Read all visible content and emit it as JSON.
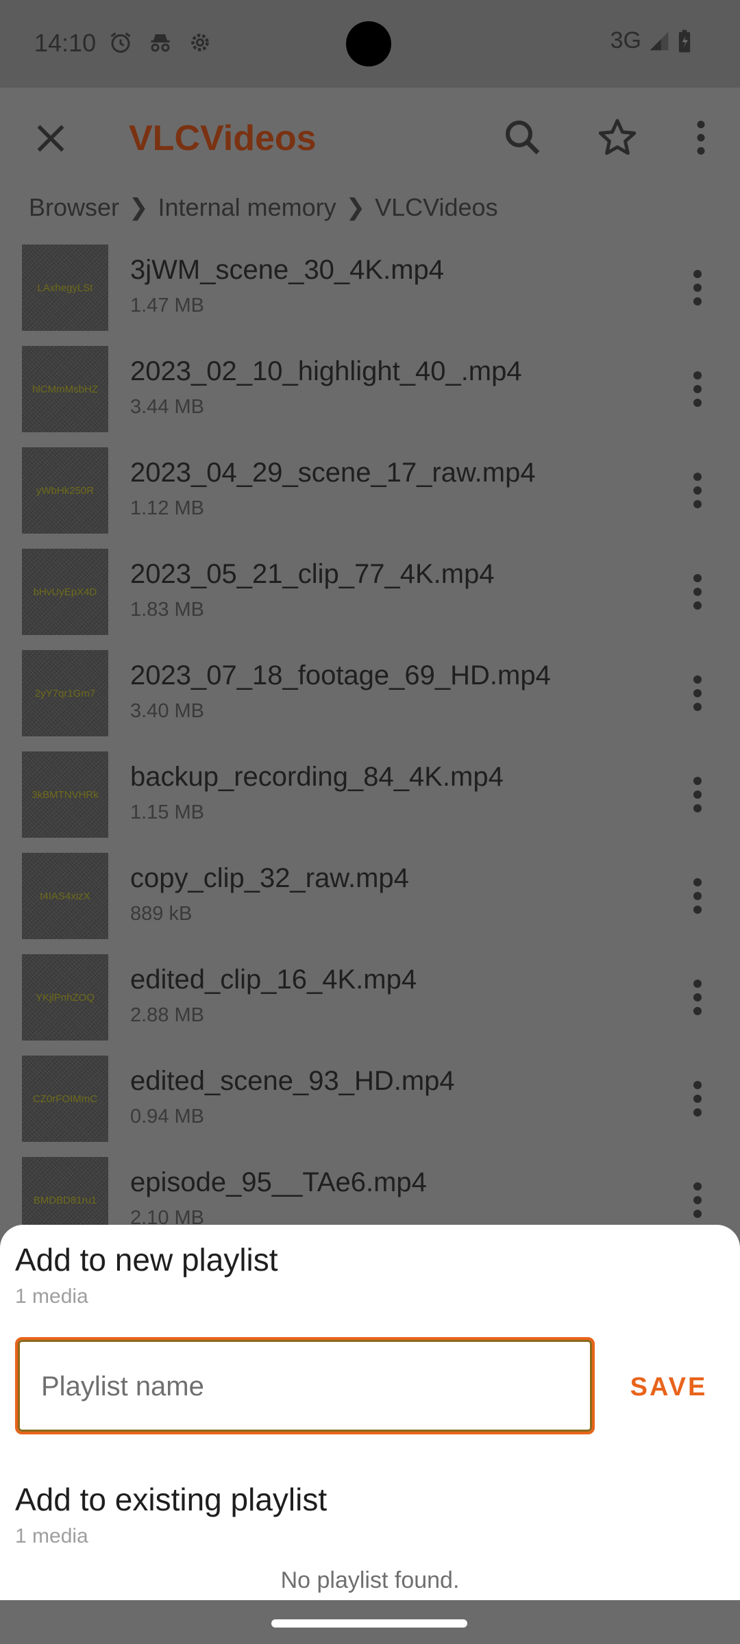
{
  "status_bar": {
    "time": "14:10",
    "network": "3G",
    "icons": [
      "alarm-icon",
      "incognito-icon",
      "settings-icon",
      "signal-icon",
      "battery-charging-icon"
    ]
  },
  "app_bar": {
    "title": "VLCVideos",
    "title_color": "#7a3212",
    "actions": [
      "close-icon",
      "search-icon",
      "star-icon",
      "more-vert-icon"
    ]
  },
  "breadcrumb": {
    "items": [
      "Browser",
      "Internal memory",
      "VLCVideos"
    ],
    "separator": "❯"
  },
  "files": [
    {
      "thumb_text": "LAxhegyLSt",
      "name": "3jWM_scene_30_4K.mp4",
      "size": "1.47 MB"
    },
    {
      "thumb_text": "hlCMmMsbHZ",
      "name": "2023_02_10_highlight_40_.mp4",
      "size": "3.44 MB"
    },
    {
      "thumb_text": "yWbHk250R",
      "name": "2023_04_29_scene_17_raw.mp4",
      "size": "1.12 MB"
    },
    {
      "thumb_text": "bHvUyEpX4D",
      "name": "2023_05_21_clip_77_4K.mp4",
      "size": "1.83 MB"
    },
    {
      "thumb_text": "2yY7qr1Gm7",
      "name": "2023_07_18_footage_69_HD.mp4",
      "size": "3.40 MB"
    },
    {
      "thumb_text": "3kBMTNVHRk",
      "name": "backup_recording_84_4K.mp4",
      "size": "1.15 MB"
    },
    {
      "thumb_text": "t4IAS4xizX",
      "name": "copy_clip_32_raw.mp4",
      "size": "889 kB"
    },
    {
      "thumb_text": "YKjlPnhZOQ",
      "name": "edited_clip_16_4K.mp4",
      "size": "2.88 MB"
    },
    {
      "thumb_text": "CZ0rFOIMmC",
      "name": "edited_scene_93_HD.mp4",
      "size": "0.94 MB"
    },
    {
      "thumb_text": "BMDBD81ru1",
      "name": "episode_95__TAe6.mp4",
      "size": "2.10 MB"
    }
  ],
  "sheet": {
    "new_playlist_title": "Add to new playlist",
    "new_playlist_sub": "1 media",
    "playlist_name_placeholder": "Playlist name",
    "playlist_name_value": "",
    "save_label": "SAVE",
    "existing_playlist_title": "Add to existing playlist",
    "existing_playlist_sub": "1 media",
    "empty_message": "No playlist found.",
    "accent_color": "#e8641b"
  }
}
